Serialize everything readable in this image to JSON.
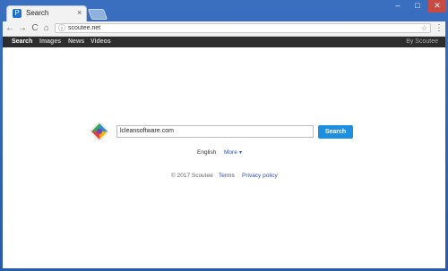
{
  "browser": {
    "tab_title": "Search",
    "tab_icon": "search-favicon",
    "tab_close": "×",
    "url": "scoutee.net",
    "window_min": "–",
    "window_max": "□",
    "window_close": "✕",
    "back": "←",
    "forward": "→",
    "reload": "C",
    "home": "⌂",
    "info": "ⓘ",
    "star": "☆",
    "menu": "⋮"
  },
  "site_nav": {
    "items": [
      "Search",
      "Images",
      "News",
      "Videos"
    ],
    "brand": "By Scoutee"
  },
  "search": {
    "value": "lcleansoftware.com",
    "button": "Search"
  },
  "options": {
    "language": "English",
    "more": "More",
    "caret": "▾"
  },
  "footer": {
    "copyright": "© 2017 Scoutee",
    "terms": "Terms",
    "privacy": "Privacy policy"
  },
  "colors": {
    "accent": "#1d8fe0",
    "nav_bar": "#2d2d2d",
    "link": "#2a4fb0"
  }
}
